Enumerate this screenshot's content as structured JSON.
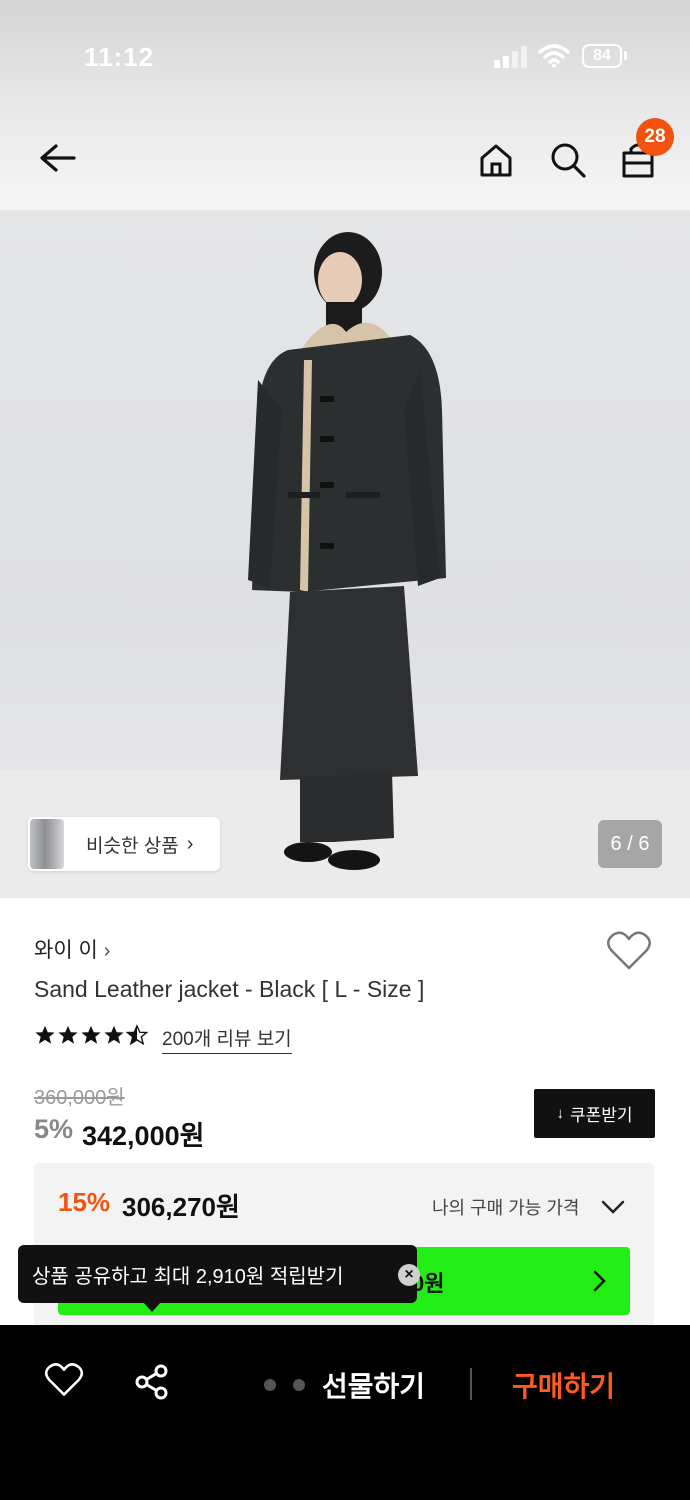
{
  "status_bar": {
    "time": "11:12",
    "battery": "84"
  },
  "header": {
    "back_icon": "back-arrow-icon",
    "home_icon": "home-icon",
    "search_icon": "search-icon",
    "cart_icon": "shopping-bag-icon",
    "cart_count": "28"
  },
  "gallery": {
    "similar_label": "비슷한 상품",
    "similar_chevron": "›",
    "counter": "6 / 6"
  },
  "product": {
    "brand": "와이 이",
    "brand_chevron": "›",
    "title": "Sand Leather jacket - Black [ L - Size ]",
    "rating": 4.5,
    "review_link": "200개 리뷰 보기",
    "original_price": "360,000원",
    "discount_rate": "5%",
    "sale_price": "342,000원",
    "coupon_label": "쿠폰받기",
    "coupon_icon": "↓"
  },
  "my_price": {
    "rate": "15%",
    "price": "306,270원",
    "label": "나의 구매 가능 가격",
    "button_text_partial": "0원"
  },
  "tooltip": {
    "text": "상품 공유하고 최대 2,910원 적립받기",
    "close": "×"
  },
  "bottom_bar": {
    "gift_label": "선물하기",
    "buy_label": "구매하기"
  },
  "colors": {
    "accent_orange": "#f2530f",
    "buy_orange": "#ff5a1f",
    "green": "#22ee16"
  }
}
